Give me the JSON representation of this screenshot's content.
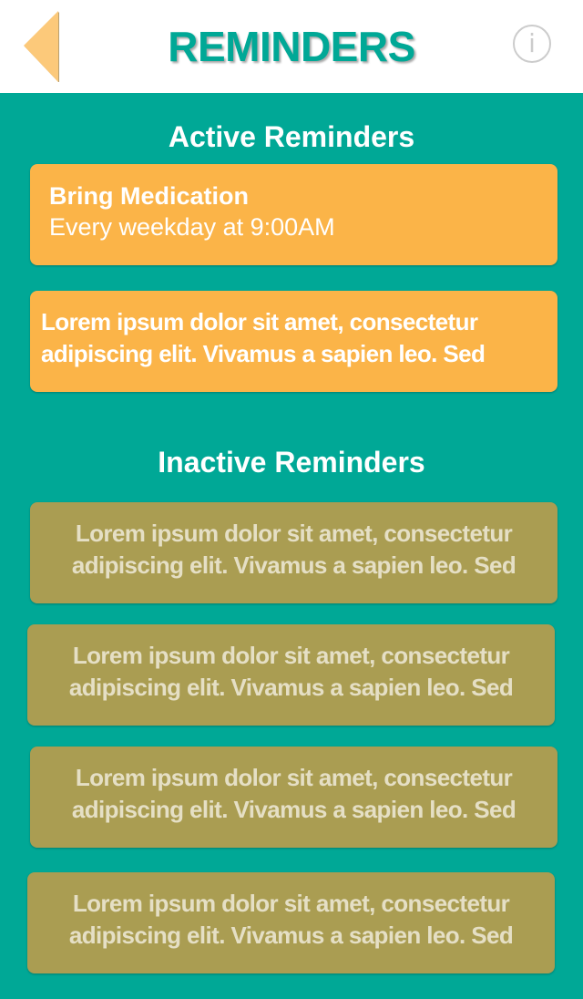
{
  "header": {
    "title": "REMINDERS",
    "back_icon": "back-triangle-icon",
    "info_icon": "info-icon",
    "info_glyph": "i"
  },
  "colors": {
    "primary": "#00A896",
    "active_card": "#FBB448",
    "inactive_card": "#AA9D52",
    "back_arrow": "#FCC97A"
  },
  "active": {
    "heading": "Active Reminders",
    "items": [
      {
        "title": "Bring Medication",
        "schedule": "Every weekday at 9:00AM"
      },
      {
        "text": "Lorem ipsum dolor sit amet, consectetur adipiscing elit. Vivamus a sapien leo. Sed"
      }
    ]
  },
  "inactive": {
    "heading": "Inactive Reminders",
    "items": [
      {
        "text": "Lorem ipsum dolor sit amet, consectetur adipiscing elit. Vivamus a sapien leo. Sed"
      },
      {
        "text": "Lorem ipsum dolor sit amet, consectetur adipiscing elit. Vivamus a sapien leo. Sed"
      },
      {
        "text": "Lorem ipsum dolor sit amet, consectetur adipiscing elit. Vivamus a sapien leo. Sed"
      },
      {
        "text": "Lorem ipsum dolor sit amet, consectetur adipiscing elit. Vivamus a sapien leo. Sed"
      }
    ]
  }
}
